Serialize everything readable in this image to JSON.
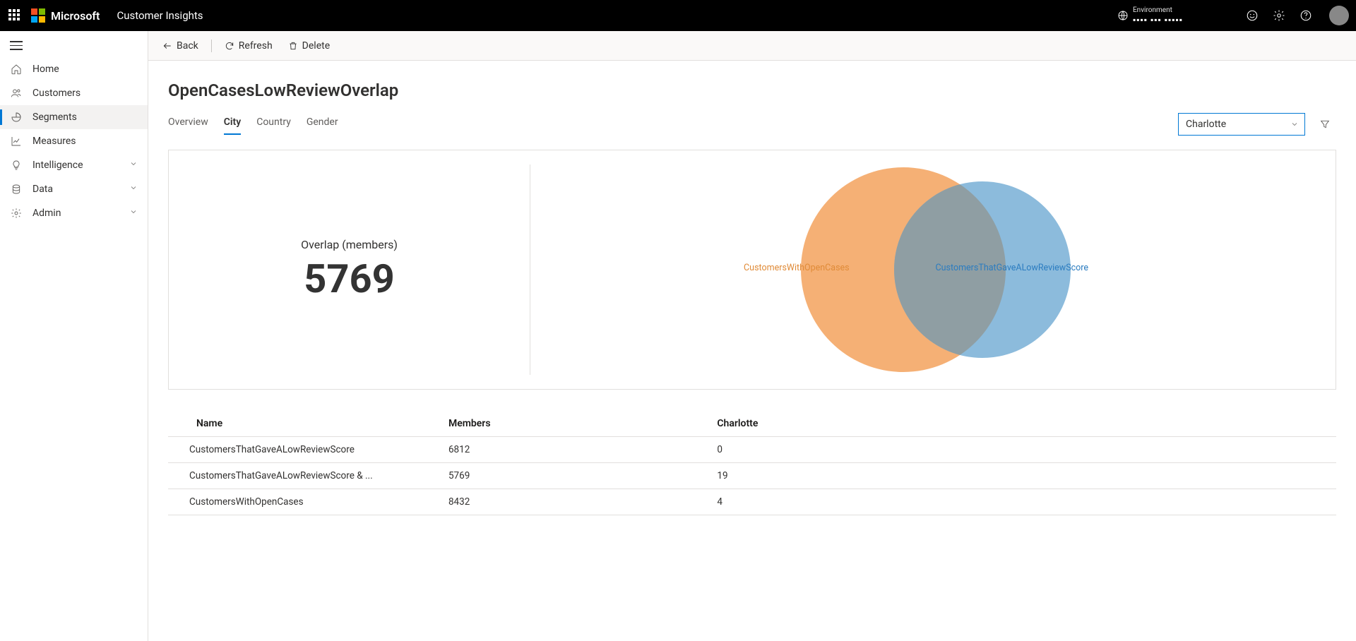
{
  "brand": {
    "ms": "Microsoft",
    "app": "Customer Insights"
  },
  "env": {
    "label": "Environment",
    "value": "▪▪▪▪ ▪▪▪ ▪▪▪▪▪"
  },
  "nav": {
    "items": [
      {
        "key": "home",
        "label": "Home"
      },
      {
        "key": "customers",
        "label": "Customers"
      },
      {
        "key": "segments",
        "label": "Segments"
      },
      {
        "key": "measures",
        "label": "Measures"
      },
      {
        "key": "intelligence",
        "label": "Intelligence"
      },
      {
        "key": "data",
        "label": "Data"
      },
      {
        "key": "admin",
        "label": "Admin"
      }
    ]
  },
  "cmdbar": {
    "back": "Back",
    "refresh": "Refresh",
    "delete": "Delete"
  },
  "page": {
    "title": "OpenCasesLowReviewOverlap"
  },
  "tabs": {
    "items": [
      {
        "key": "overview",
        "label": "Overview"
      },
      {
        "key": "city",
        "label": "City"
      },
      {
        "key": "country",
        "label": "Country"
      },
      {
        "key": "gender",
        "label": "Gender"
      }
    ],
    "active": "city",
    "dropdown_value": "Charlotte"
  },
  "metric": {
    "label": "Overlap (members)",
    "value": "5769"
  },
  "venn": {
    "left_label": "CustomersWithOpenCases",
    "right_label": "CustomersThatGaveALowReviewScore",
    "colors": {
      "left": "#f4a766",
      "right": "#7fb4d8",
      "overlap": "#8f9ea3"
    }
  },
  "table": {
    "columns": {
      "name": "Name",
      "members": "Members",
      "attr": "Charlotte"
    },
    "rows": [
      {
        "name": "CustomersThatGaveALowReviewScore",
        "members": "6812",
        "attr": "0"
      },
      {
        "name": "CustomersThatGaveALowReviewScore & ...",
        "members": "5769",
        "attr": "19"
      },
      {
        "name": "CustomersWithOpenCases",
        "members": "8432",
        "attr": "4"
      }
    ]
  },
  "chart_data": {
    "type": "venn",
    "title": "Overlap (members)",
    "sets": [
      {
        "name": "CustomersWithOpenCases",
        "size": 8432
      },
      {
        "name": "CustomersThatGaveALowReviewScore",
        "size": 6812
      }
    ],
    "intersections": [
      {
        "sets": [
          "CustomersWithOpenCases",
          "CustomersThatGaveALowReviewScore"
        ],
        "size": 5769
      }
    ],
    "attribute": "Charlotte",
    "attribute_values": {
      "CustomersThatGaveALowReviewScore": 0,
      "CustomersThatGaveALowReviewScore & CustomersWithOpenCases": 19,
      "CustomersWithOpenCases": 4
    }
  }
}
